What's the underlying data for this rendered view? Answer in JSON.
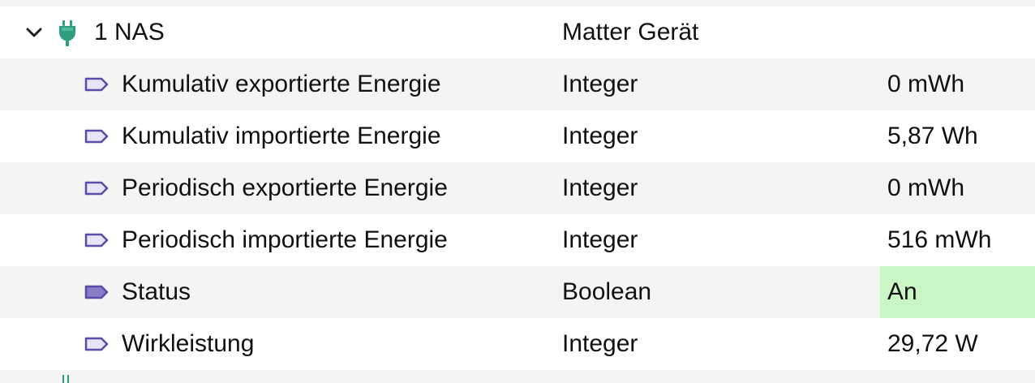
{
  "parent": {
    "name": "1 NAS",
    "type": "Matter Gerät",
    "value": ""
  },
  "rows": [
    {
      "name": "Kumulativ exportierte Energie",
      "type": "Integer",
      "value": "0 mWh"
    },
    {
      "name": "Kumulativ importierte Energie",
      "type": "Integer",
      "value": "5,87 Wh"
    },
    {
      "name": "Periodisch exportierte Energie",
      "type": "Integer",
      "value": "0 mWh"
    },
    {
      "name": "Periodisch importierte Energie",
      "type": "Integer",
      "value": "516 mWh"
    },
    {
      "name": "Status",
      "type": "Boolean",
      "value": "An"
    },
    {
      "name": "Wirkleistung",
      "type": "Integer",
      "value": "29,72 W"
    }
  ],
  "colors": {
    "alt_row": "#f4f4f4",
    "on_highlight": "#c8f7c5",
    "variable_icon": "#5b4aa8",
    "device_icon": "#2e9e7e"
  },
  "icons": {
    "expand": "chevron-down-icon",
    "device": "plug-icon",
    "variable": "variable-tag-icon"
  }
}
